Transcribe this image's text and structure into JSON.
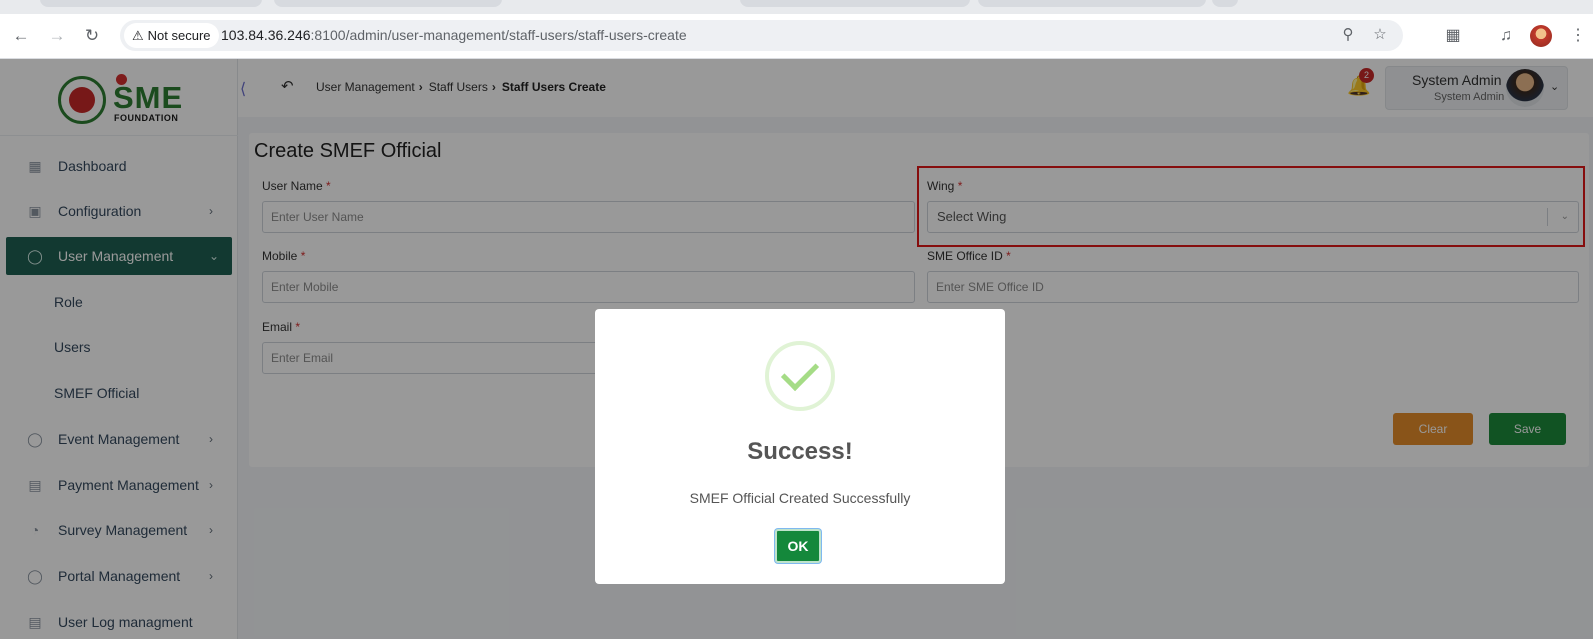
{
  "browser": {
    "security_label": "Not secure",
    "url_host": "103.84.36.246",
    "url_path": ":8100/admin/user-management/staff-users/staff-users-create"
  },
  "logo": {
    "brand": "SME",
    "sub": "FOUNDATION"
  },
  "sidebar": {
    "items": [
      {
        "label": "Dashboard",
        "icon": "grid-icon",
        "has_children": false
      },
      {
        "label": "Configuration",
        "icon": "config-icon",
        "has_children": true
      },
      {
        "label": "User Management",
        "icon": "shield-user-icon",
        "has_children": true,
        "active": true
      },
      {
        "label": "Event Management",
        "icon": "event-icon",
        "has_children": true
      },
      {
        "label": "Payment Management",
        "icon": "payment-icon",
        "has_children": true
      },
      {
        "label": "Survey Management",
        "icon": "survey-icon",
        "has_children": true
      },
      {
        "label": "Portal Management",
        "icon": "portal-icon",
        "has_children": true
      },
      {
        "label": "User Log managment",
        "icon": "log-icon",
        "has_children": false
      }
    ],
    "user_management_children": [
      "Role",
      "Users",
      "SMEF Official"
    ]
  },
  "header": {
    "breadcrumb": [
      "User Management",
      "Staff Users",
      "Staff Users Create"
    ],
    "notification_count": "2",
    "user_name": "System Admin",
    "user_role": "System Admin"
  },
  "form": {
    "title": "Create SMEF Official",
    "user_name_label": "User Name",
    "user_name_placeholder": "Enter User Name",
    "wing_label": "Wing",
    "wing_placeholder": "Select Wing",
    "mobile_label": "Mobile",
    "mobile_placeholder": "Enter Mobile",
    "office_id_label": "SME Office ID",
    "office_id_placeholder": "Enter SME Office ID",
    "email_label": "Email",
    "email_placeholder": "Enter Email",
    "required_mark": "*",
    "clear_label": "Clear",
    "save_label": "Save"
  },
  "modal": {
    "title": "Success!",
    "message": "SMEF Official Created Successfully",
    "ok_label": "OK"
  },
  "colors": {
    "sidebar_active": "#1e5f52",
    "save_button": "#1d8a3b",
    "clear_button": "#e48d2a",
    "highlight_box": "#e01616",
    "success_check": "#a5dc86"
  }
}
